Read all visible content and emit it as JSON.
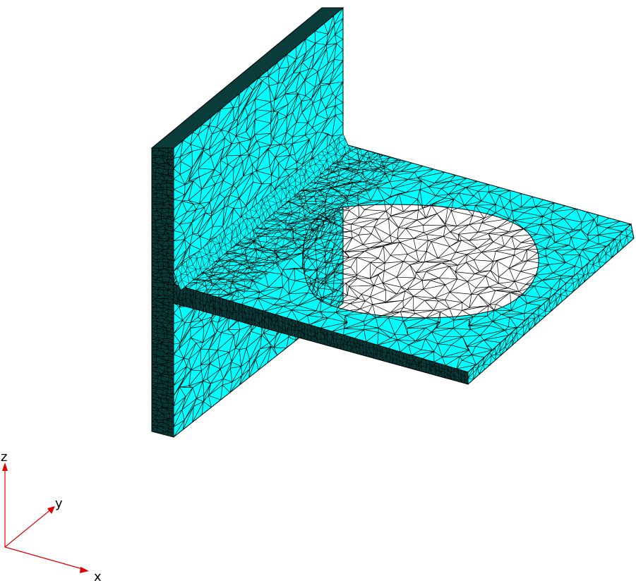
{
  "colors": {
    "background": "#ffffff",
    "mesh_fill": "#00ffff",
    "mesh_edge": "#000000",
    "axis": "#e00000"
  },
  "mesh": {
    "element_type": "tetrahedral",
    "parts": [
      "vertical-plate",
      "horizontal-plate",
      "fillet",
      "circular-hole"
    ]
  },
  "triad": {
    "x_label": "x",
    "y_label": "y",
    "z_label": "z"
  }
}
